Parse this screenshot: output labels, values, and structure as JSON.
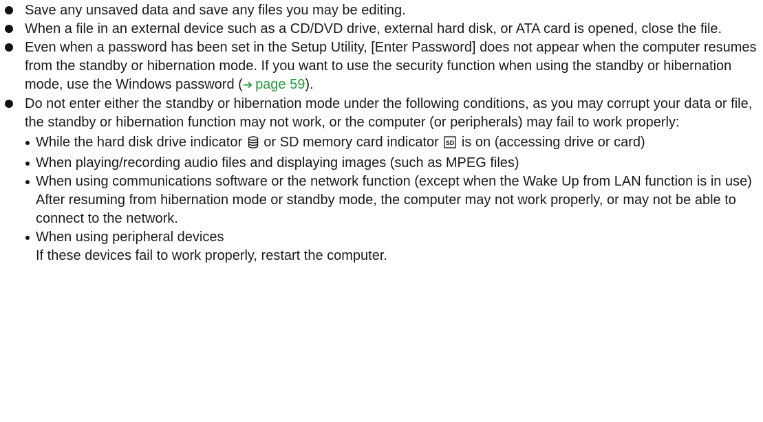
{
  "colors": {
    "text": "#1a1a1a",
    "link": "#1f9c3a"
  },
  "icons": {
    "arrow": "arrow-right-icon",
    "hdd": "hard-disk-drive-indicator-icon",
    "sd": "sd-memory-card-indicator-icon"
  },
  "items": [
    {
      "text": "Save any unsaved data and save any files you may be editing."
    },
    {
      "text": "When a file in an external device such as a CD/DVD drive, external hard disk, or ATA card is opened, close the file."
    },
    {
      "text_before": "Even when a password has been set in the Setup Utility, [Enter Password] does not appear when the computer resumes from the standby or hibernation mode. If you want to use the security function when using the standby or hibernation mode, use the Windows password (",
      "link_arrow": "➔",
      "link_text": "page 59",
      "text_after": ")."
    },
    {
      "text": "Do not enter either the standby or hibernation mode under the following conditions, as you may corrupt your data or file, the standby or hibernation function may not work, or the computer (or peripherals) may fail to work properly:",
      "sub": [
        {
          "part1": "While the hard disk drive indicator",
          "part2": "or SD memory card indicator",
          "part3": "is on (accessing drive or card)"
        },
        {
          "text": "When playing/recording audio files and displaying images (such as MPEG files)"
        },
        {
          "text": "When using communications software or the network function (except when the Wake Up from LAN function is in use)",
          "note": "After resuming from hibernation mode or standby mode, the computer may not work properly, or may not be able to connect to the network."
        },
        {
          "text": "When using peripheral devices",
          "note": "If these devices fail to work properly, restart the computer."
        }
      ]
    }
  ]
}
